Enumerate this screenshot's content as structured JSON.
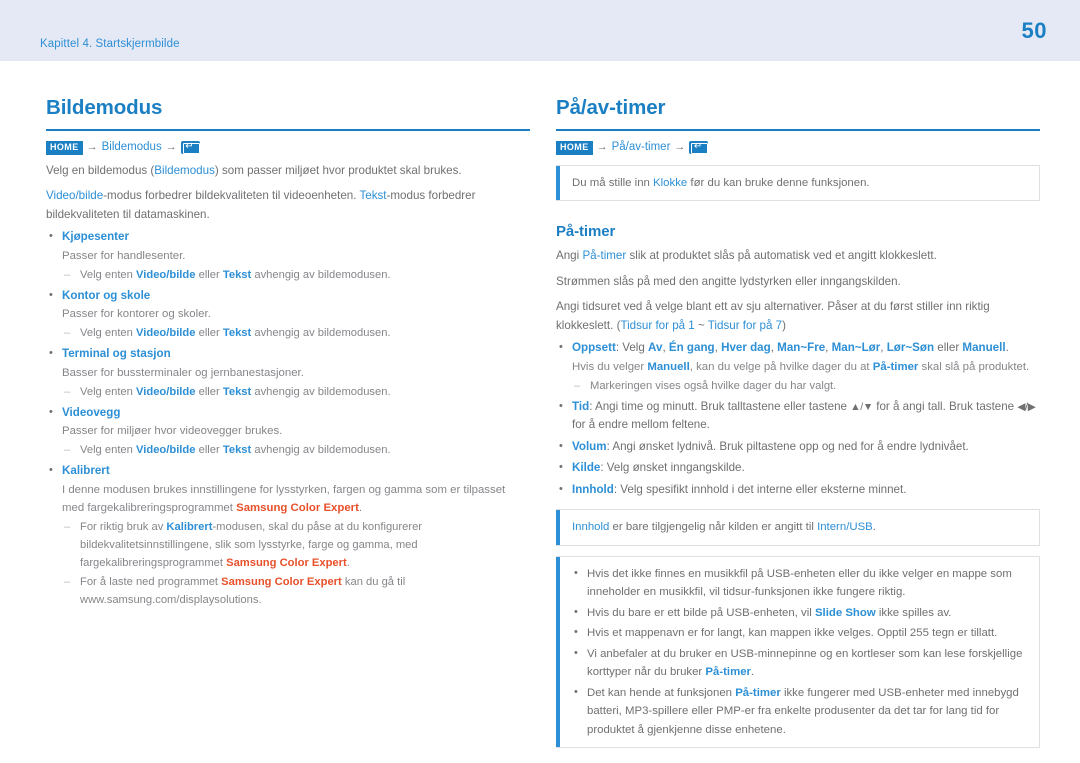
{
  "header": {
    "chapter": "Kapittel 4. Startskjermbilde",
    "page_number": "50",
    "band_color": "#e5e9f5",
    "accent_color": "#1b7fc4",
    "link_color": "#2d8fd5",
    "red_color": "#e8502a"
  },
  "left": {
    "title": "Bildemodus",
    "breadcrumb": {
      "home": "HOME",
      "arrow1": "→",
      "link": "Bildemodus",
      "arrow2": "→",
      "enter_icon": "enter-key-icon"
    },
    "intro": {
      "line1_a": "Velg en bildemodus (",
      "line1_hl": "Bildemodus",
      "line1_b": ") som passer miljøet hvor produktet skal brukes.",
      "line2_hl1": "Video/bilde",
      "line2_a": "-modus forbedrer bildekvaliteten til videoenheten. ",
      "line2_hl2": "Tekst",
      "line2_b": "-modus forbedrer bildekvaliteten til datamaskinen."
    },
    "items": [
      {
        "term": "Kjøpesenter",
        "desc": "Passer for handlesenter.",
        "sub_a": "Velg enten ",
        "sub_hl1": "Video/bilde",
        "sub_b": " eller ",
        "sub_hl2": "Tekst",
        "sub_c": " avhengig av bildemodusen."
      },
      {
        "term": "Kontor og skole",
        "desc": "Passer for kontorer og skoler.",
        "sub_a": "Velg enten ",
        "sub_hl1": "Video/bilde",
        "sub_b": " eller ",
        "sub_hl2": "Tekst",
        "sub_c": " avhengig av bildemodusen."
      },
      {
        "term": "Terminal og stasjon",
        "desc": "Basser for bussterminaler og jernbanestasjoner.",
        "sub_a": "Velg enten ",
        "sub_hl1": "Video/bilde",
        "sub_b": " eller ",
        "sub_hl2": "Tekst",
        "sub_c": " avhengig av bildemodusen."
      },
      {
        "term": "Videovegg",
        "desc": "Passer for miljøer hvor videovegger brukes.",
        "sub_a": "Velg enten ",
        "sub_hl1": "Video/bilde",
        "sub_b": " eller ",
        "sub_hl2": "Tekst",
        "sub_c": " avhengig av bildemodusen."
      }
    ],
    "kalibrert": {
      "term": "Kalibrert",
      "desc_a": "I denne modusen brukes innstillingene for lysstyrken, fargen og gamma som er tilpasset med fargekalibreringsprogrammet ",
      "desc_red": "Samsung Color Expert",
      "desc_b": ".",
      "sub1_a": "For riktig bruk av ",
      "sub1_hl": "Kalibrert",
      "sub1_b": "-modusen, skal du påse at du konfigurerer bildekvalitetsinnstillingene, slik som lysstyrke, farge og gamma, med fargekalibreringsprogrammet ",
      "sub1_red": "Samsung Color Expert",
      "sub1_c": ".",
      "sub2_a": "For å laste ned programmet ",
      "sub2_red": "Samsung Color Expert",
      "sub2_b": " kan du gå til www.samsung.com/displaysolutions."
    }
  },
  "right": {
    "title": "På/av-timer",
    "breadcrumb": {
      "home": "HOME",
      "arrow1": "→",
      "link": "På/av-timer",
      "arrow2": "→",
      "enter_icon": "enter-key-icon"
    },
    "note_clock": {
      "a": "Du må stille inn ",
      "hl": "Klokke",
      "b": " før du kan bruke denne funksjonen."
    },
    "sub_title": "På-timer",
    "paragraphs": {
      "p1_a": "Angi ",
      "p1_hl": "På-timer",
      "p1_b": " slik at produktet slås på automatisk ved et angitt klokkeslett.",
      "p2": "Strømmen slås på med den angitte lydstyrken eller inngangskilden.",
      "p3_a": "Angi tidsuret ved å velge blant ett av sju alternativer. Påser at du først stiller inn riktig klokkeslett. (",
      "p3_hl1": "Tidsur for på 1",
      "p3_mid": " ~ ",
      "p3_hl2": "Tidsur for på 7",
      "p3_b": ")"
    },
    "options": {
      "oppsett_term": "Oppsett",
      "oppsett_a": ": Velg ",
      "oppsett_values": [
        "Av",
        "Én gang",
        "Hver dag",
        "Man~Fre",
        "Man~Lør",
        "Lør~Søn"
      ],
      "oppsett_sep": ", ",
      "oppsett_eller": " eller ",
      "oppsett_last": "Manuell",
      "oppsett_end": ".",
      "oppsett_desc_a": "Hvis du velger ",
      "oppsett_desc_hl1": "Manuell",
      "oppsett_desc_b": ", kan du velge på hvilke dager du at ",
      "oppsett_desc_hl2": "På-timer",
      "oppsett_desc_c": " skal slå på produktet.",
      "oppsett_sub": "Markeringen vises også hvilke dager du har valgt.",
      "tid_term": "Tid",
      "tid_a": ": Angi time og minutt. Bruk talltastene eller tastene ",
      "tid_arrow_ud": "▲/▼",
      "tid_b": " for å angi tall. Bruk tastene ",
      "tid_arrow_lr": "◀/▶",
      "tid_c": " for å endre mellom feltene.",
      "volum_term": "Volum",
      "volum_text": ": Angi ønsket lydnivå. Bruk piltastene opp og ned for å endre lydnivået.",
      "kilde_term": "Kilde",
      "kilde_text": ": Velg ønsket inngangskilde.",
      "innhold_term": "Innhold",
      "innhold_text": ": Velg spesifikt innhold i det interne eller eksterne minnet."
    },
    "note_innhold": {
      "hl1": "Innhold",
      "a": " er bare tilgjengelig når kilden er angitt til ",
      "hl2": "Intern/USB",
      "b": "."
    },
    "note_usb": {
      "items": [
        {
          "a": "Hvis det ikke finnes en musikkfil på USB-enheten eller du ikke velger en mappe som inneholder en musikkfil, vil tidsur-funksjonen ikke fungere riktig."
        },
        {
          "a": "Hvis du bare er ett bilde på USB-enheten, vil ",
          "hl": "Slide Show",
          "b": " ikke spilles av."
        },
        {
          "a": "Hvis et mappenavn er for langt, kan mappen ikke velges. Opptil 255 tegn er tillatt."
        },
        {
          "a": "Vi anbefaler at du bruker en USB-minnepinne og en kortleser som kan lese forskjellige korttyper når du bruker ",
          "hl": "På-timer",
          "b": "."
        },
        {
          "a": "Det kan hende at funksjonen ",
          "hl": "På-timer",
          "b": " ikke fungerer med USB-enheter med innebygd batteri, MP3-spillere eller PMP-er fra enkelte produsenter da det tar for lang tid for produktet å gjenkjenne disse enhetene."
        }
      ]
    }
  }
}
